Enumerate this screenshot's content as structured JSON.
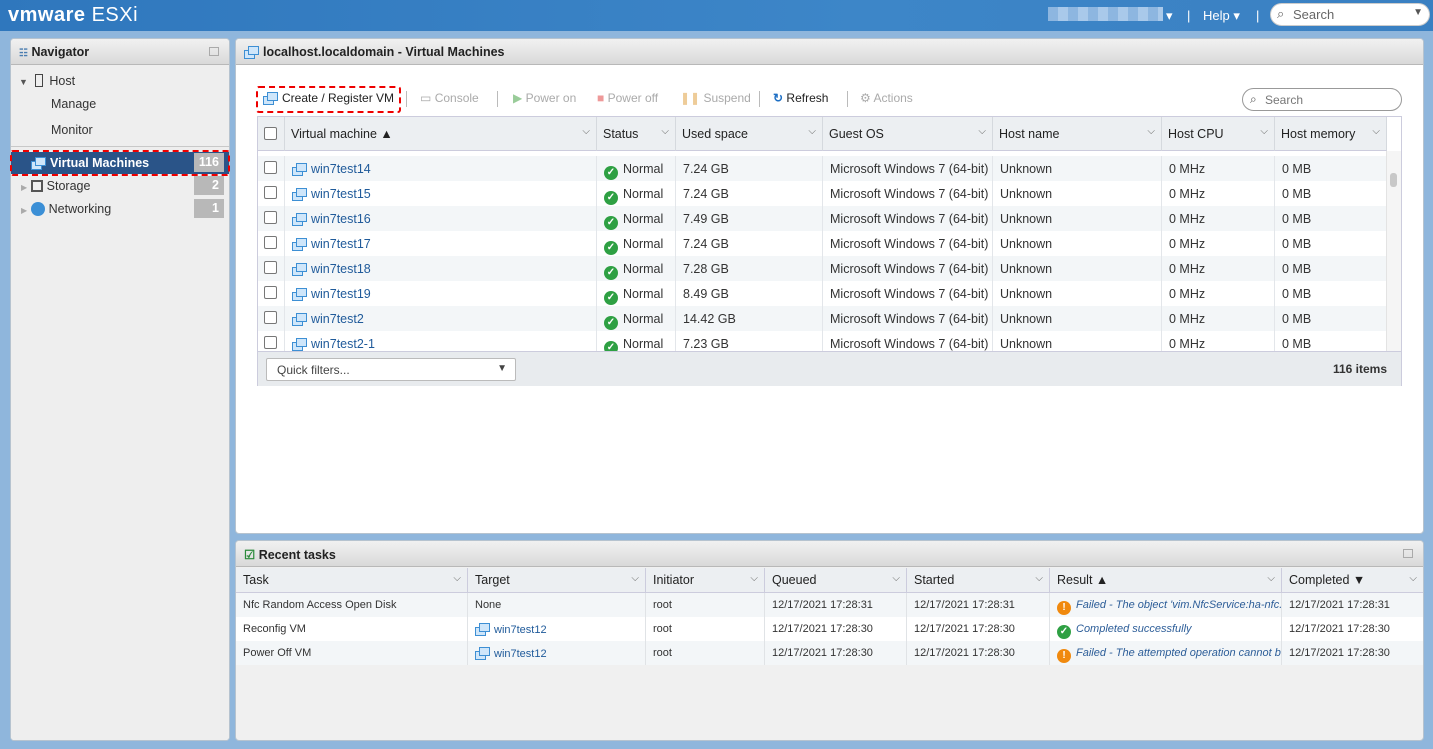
{
  "app": {
    "logo": "vmware",
    "product": "ESXi",
    "help": "Help",
    "search_placeholder": "Search"
  },
  "navigator": {
    "title": "Navigator",
    "items": [
      {
        "label": "Host"
      },
      {
        "label": "Manage"
      },
      {
        "label": "Monitor"
      },
      {
        "label": "Virtual Machines",
        "count": "116"
      },
      {
        "label": "Storage",
        "count": "2"
      },
      {
        "label": "Networking",
        "count": "1"
      }
    ]
  },
  "main": {
    "title": "localhost.localdomain - Virtual Machines",
    "toolbar": {
      "create": "Create / Register VM",
      "console": "Console",
      "power_on": "Power on",
      "power_off": "Power off",
      "suspend": "Suspend",
      "refresh": "Refresh",
      "actions": "Actions",
      "search_placeholder": "Search"
    },
    "columns": [
      "Virtual machine ▲",
      "Status",
      "Used space",
      "Guest OS",
      "Host name",
      "Host CPU",
      "Host memory"
    ],
    "rows": [
      [
        "win7test14",
        "Normal",
        "7.24 GB",
        "Microsoft Windows 7 (64-bit)",
        "Unknown",
        "0 MHz",
        "0 MB"
      ],
      [
        "win7test15",
        "Normal",
        "7.24 GB",
        "Microsoft Windows 7 (64-bit)",
        "Unknown",
        "0 MHz",
        "0 MB"
      ],
      [
        "win7test16",
        "Normal",
        "7.49 GB",
        "Microsoft Windows 7 (64-bit)",
        "Unknown",
        "0 MHz",
        "0 MB"
      ],
      [
        "win7test17",
        "Normal",
        "7.24 GB",
        "Microsoft Windows 7 (64-bit)",
        "Unknown",
        "0 MHz",
        "0 MB"
      ],
      [
        "win7test18",
        "Normal",
        "7.28 GB",
        "Microsoft Windows 7 (64-bit)",
        "Unknown",
        "0 MHz",
        "0 MB"
      ],
      [
        "win7test19",
        "Normal",
        "8.49 GB",
        "Microsoft Windows 7 (64-bit)",
        "Unknown",
        "0 MHz",
        "0 MB"
      ],
      [
        "win7test2",
        "Normal",
        "14.42 GB",
        "Microsoft Windows 7 (64-bit)",
        "Unknown",
        "0 MHz",
        "0 MB"
      ],
      [
        "win7test2-1",
        "Normal",
        "7.23 GB",
        "Microsoft Windows 7 (64-bit)",
        "Unknown",
        "0 MHz",
        "0 MB"
      ]
    ],
    "quick_filters": "Quick filters...",
    "item_count": "116 items"
  },
  "tasks": {
    "title": "Recent tasks",
    "columns": [
      "Task",
      "Target",
      "Initiator",
      "Queued",
      "Started",
      "Result ▲",
      "Completed ▼"
    ],
    "rows": [
      {
        "task": "Nfc Random Access Open Disk",
        "target": "None",
        "target_vm": false,
        "initiator": "root",
        "queued": "12/17/2021 17:28:31",
        "started": "12/17/2021 17:28:31",
        "result": "Failed - The object 'vim.NfcService:ha-nfc...",
        "status": "failed",
        "completed": "12/17/2021 17:28:31"
      },
      {
        "task": "Reconfig VM",
        "target": "win7test12",
        "target_vm": true,
        "initiator": "root",
        "queued": "12/17/2021 17:28:30",
        "started": "12/17/2021 17:28:30",
        "result": "Completed successfully",
        "status": "success",
        "completed": "12/17/2021 17:28:30"
      },
      {
        "task": "Power Off VM",
        "target": "win7test12",
        "target_vm": true,
        "initiator": "root",
        "queued": "12/17/2021 17:28:30",
        "started": "12/17/2021 17:28:30",
        "result": "Failed - The attempted operation cannot b...",
        "status": "failed",
        "completed": "12/17/2021 17:28:30"
      }
    ]
  }
}
